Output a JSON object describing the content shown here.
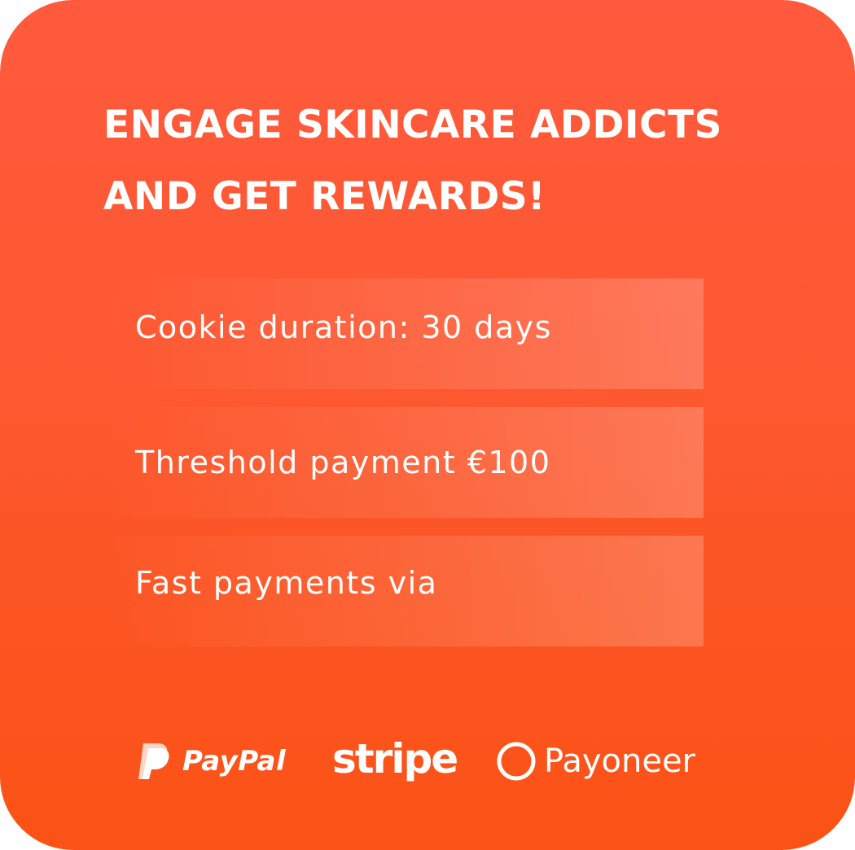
{
  "headline": {
    "line1": "ENGAGE SKINCARE ADDICTS",
    "line2": "AND GET REWARDS!"
  },
  "features": [
    {
      "label": "Cookie duration: 30 days"
    },
    {
      "label": "Threshold payment €100"
    },
    {
      "label": "Fast payments via"
    }
  ],
  "payment_logos": [
    {
      "name": "PayPal",
      "icon": "paypal-icon"
    },
    {
      "name": "stripe",
      "icon": "stripe-wordmark"
    },
    {
      "name": "Payoneer",
      "icon": "payoneer-ring-icon"
    }
  ],
  "colors": {
    "gradient_top": "#ff5a3d",
    "gradient_bottom": "#fb5215",
    "text": "#ffffff"
  }
}
